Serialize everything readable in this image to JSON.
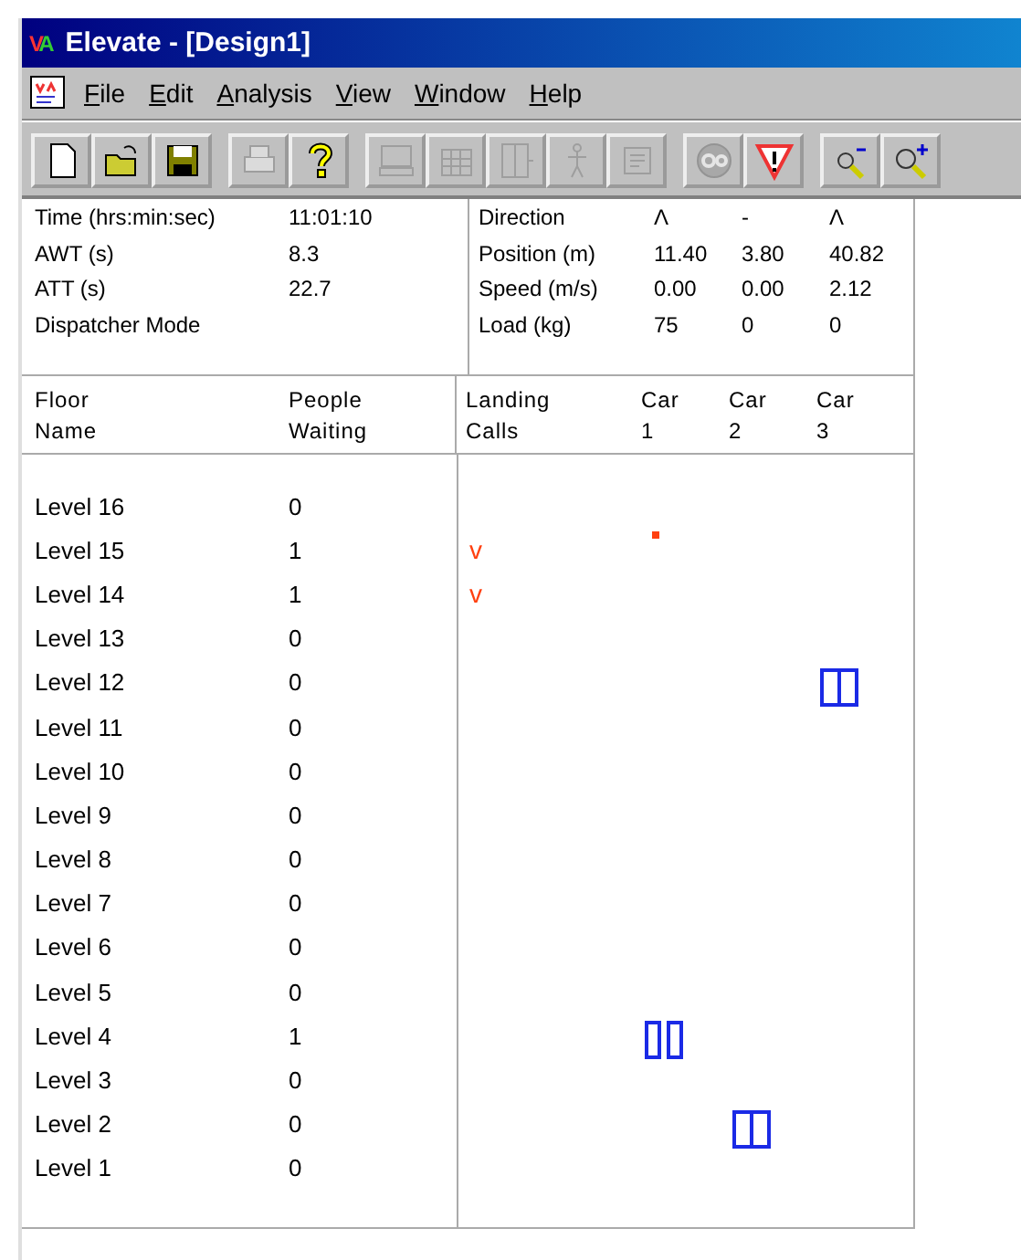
{
  "window": {
    "logo": "VA",
    "title": "Elevate - [Design1]"
  },
  "menu": [
    "File",
    "Edit",
    "Analysis",
    "View",
    "Window",
    "Help"
  ],
  "toolbar": [
    [
      {
        "kind": "new",
        "disabled": false
      },
      {
        "kind": "open",
        "disabled": false
      },
      {
        "kind": "save",
        "disabled": false
      }
    ],
    [
      {
        "kind": "print",
        "disabled": true
      },
      {
        "kind": "help",
        "disabled": false
      }
    ],
    [
      {
        "kind": "computer",
        "disabled": true
      },
      {
        "kind": "building",
        "disabled": true
      },
      {
        "kind": "door",
        "disabled": true
      },
      {
        "kind": "person",
        "disabled": true
      },
      {
        "kind": "form",
        "disabled": true
      }
    ],
    [
      {
        "kind": "go",
        "disabled": true
      },
      {
        "kind": "warning",
        "disabled": false
      }
    ],
    [
      {
        "kind": "zoom-out",
        "disabled": false
      },
      {
        "kind": "zoom-in",
        "disabled": false
      }
    ]
  ],
  "stats": [
    {
      "label": "Time (hrs:min:sec)",
      "value": "11:01:10"
    },
    {
      "label": "AWT (s)",
      "value": "8.3"
    },
    {
      "label": "ATT (s)",
      "value": "22.7"
    },
    {
      "label": "Dispatcher Mode"
    }
  ],
  "car_stats": [
    {
      "label": "Direction",
      "values": [
        "Λ",
        "-",
        "Λ"
      ]
    },
    {
      "label": "Position (m)",
      "values": [
        "11.40",
        "3.80",
        "40.82"
      ]
    },
    {
      "label": "Speed (m/s)",
      "values": [
        "0.00",
        "0.00",
        "2.12"
      ]
    },
    {
      "label": "Load (kg)",
      "values": [
        "75",
        "0",
        "0"
      ]
    }
  ],
  "columns": [
    [
      "Floor",
      "Name"
    ],
    [
      "People",
      "Waiting"
    ],
    [
      "Landing",
      "Calls"
    ],
    [
      "Car",
      "1"
    ],
    [
      "Car",
      "2"
    ],
    [
      "Car",
      "3"
    ]
  ],
  "floors": [
    {
      "name": "Level 16",
      "waiting": "0",
      "cars": [
        {
          "kind": "empty"
        },
        {
          "kind": "empty"
        },
        {
          "kind": "empty"
        }
      ]
    },
    {
      "name": "Level 15",
      "waiting": "1",
      "call": "v",
      "cars": [
        {
          "kind": "call"
        },
        {
          "kind": "empty"
        },
        {
          "kind": "empty"
        }
      ]
    },
    {
      "name": "Level 14",
      "waiting": "1",
      "call": "v",
      "cars": [
        {
          "kind": "empty"
        },
        {
          "kind": "empty"
        },
        {
          "kind": "empty"
        }
      ]
    },
    {
      "name": "Level 13",
      "waiting": "0",
      "cars": [
        {
          "kind": "empty"
        },
        {
          "kind": "empty"
        },
        {
          "kind": "empty"
        }
      ]
    },
    {
      "name": "Level 12",
      "waiting": "0",
      "cars": [
        {
          "kind": "empty"
        },
        {
          "kind": "empty"
        },
        {
          "kind": "closed"
        }
      ]
    },
    {
      "name": "Level 11",
      "waiting": "0",
      "cars": [
        {
          "kind": "empty"
        },
        {
          "kind": "empty"
        },
        {
          "kind": "empty"
        }
      ]
    },
    {
      "name": "Level 10",
      "waiting": "0",
      "cars": [
        {
          "kind": "empty"
        },
        {
          "kind": "empty"
        },
        {
          "kind": "empty"
        }
      ]
    },
    {
      "name": "Level 9",
      "waiting": "0",
      "cars": [
        {
          "kind": "empty"
        },
        {
          "kind": "empty"
        },
        {
          "kind": "empty"
        }
      ]
    },
    {
      "name": "Level 8",
      "waiting": "0",
      "cars": [
        {
          "kind": "empty"
        },
        {
          "kind": "empty"
        },
        {
          "kind": "empty"
        }
      ]
    },
    {
      "name": "Level 7",
      "waiting": "0",
      "cars": [
        {
          "kind": "empty"
        },
        {
          "kind": "empty"
        },
        {
          "kind": "empty"
        }
      ]
    },
    {
      "name": "Level 6",
      "waiting": "0",
      "cars": [
        {
          "kind": "empty"
        },
        {
          "kind": "empty"
        },
        {
          "kind": "empty"
        }
      ]
    },
    {
      "name": "Level 5",
      "waiting": "0",
      "cars": [
        {
          "kind": "empty"
        },
        {
          "kind": "empty"
        },
        {
          "kind": "empty"
        }
      ]
    },
    {
      "name": "Level 4",
      "waiting": "1",
      "cars": [
        {
          "kind": "open"
        },
        {
          "kind": "empty"
        },
        {
          "kind": "empty"
        }
      ]
    },
    {
      "name": "Level 3",
      "waiting": "0",
      "cars": [
        {
          "kind": "empty"
        },
        {
          "kind": "empty"
        },
        {
          "kind": "empty"
        }
      ]
    },
    {
      "name": "Level 2",
      "waiting": "0",
      "cars": [
        {
          "kind": "empty"
        },
        {
          "kind": "closed"
        },
        {
          "kind": "empty"
        }
      ]
    },
    {
      "name": "Level 1",
      "waiting": "0",
      "cars": [
        {
          "kind": "empty"
        },
        {
          "kind": "empty"
        },
        {
          "kind": "empty"
        }
      ]
    }
  ]
}
